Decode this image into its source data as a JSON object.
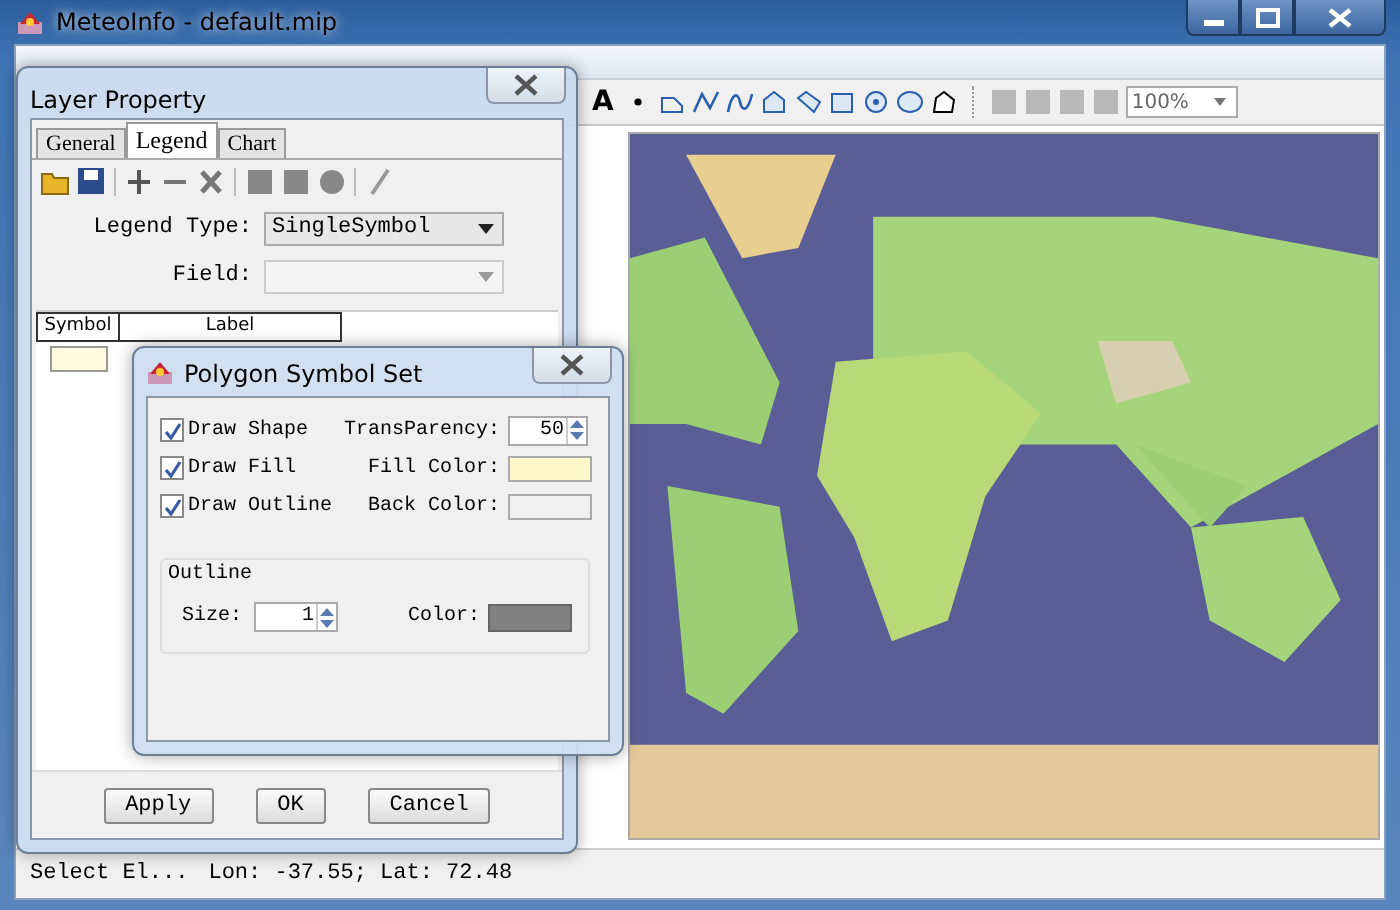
{
  "window": {
    "title": "MeteoInfo - default.mip"
  },
  "toolbar": {
    "text_tool": "A",
    "zoom": "100%"
  },
  "layer_property": {
    "title": "Layer Property",
    "tabs": [
      {
        "label": "General",
        "selected": false
      },
      {
        "label": "Legend",
        "selected": true
      },
      {
        "label": "Chart",
        "selected": false
      }
    ],
    "legend_type": {
      "label": "Legend Type:",
      "value": "SingleSymbol"
    },
    "field": {
      "label": "Field:"
    },
    "table": {
      "columns": [
        "Symbol",
        "Label"
      ],
      "rows": [
        {
          "color": "#fffbe0"
        }
      ]
    },
    "buttons": [
      "Apply",
      "OK",
      "Cancel"
    ]
  },
  "polygon_symbol_set": {
    "title": "Polygon Symbol Set",
    "options": [
      {
        "label": "Draw Shape",
        "checked": true,
        "setting_label": "TransParency:",
        "kind": "spinner",
        "value": "50"
      },
      {
        "label": "Draw Fill",
        "checked": true,
        "setting_label": "Fill Color:",
        "kind": "color",
        "color": "#fff8c8"
      },
      {
        "label": "Draw Outline",
        "checked": true,
        "setting_label": "Back Color:",
        "kind": "color",
        "color": "#f0f0f0"
      }
    ],
    "outline": {
      "title": "Outline",
      "size_label": "Size:",
      "size": "1",
      "color_label": "Color:",
      "color": "#808080"
    }
  },
  "status_bar": {
    "message": "Select El...",
    "coords": "Lon: -37.55; Lat: 72.48"
  }
}
